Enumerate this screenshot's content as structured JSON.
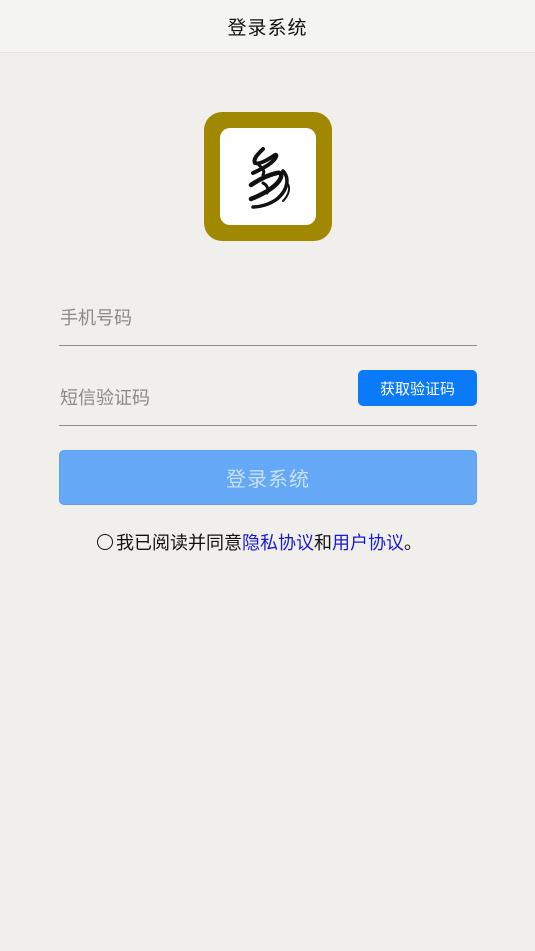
{
  "header": {
    "title": "登录系统"
  },
  "logo": {
    "icon": "app-logo-calligraphy",
    "colors": {
      "frame": "#a08800",
      "inner": "#ffffff"
    }
  },
  "form": {
    "phone": {
      "placeholder": "手机号码",
      "value": ""
    },
    "code": {
      "placeholder": "短信验证码",
      "value": "",
      "get_code_label": "获取验证码"
    },
    "login_label": "登录系统"
  },
  "agreement": {
    "checked": false,
    "prefix": "我已阅读并同意",
    "privacy_link": "隐私协议",
    "conjunction": "和",
    "user_link": "用户协议",
    "suffix": "。"
  },
  "colors": {
    "primary": "#0a7af8",
    "primary_disabled": "#64a8f6",
    "link": "#1a1ad6",
    "background": "#f0efec"
  }
}
